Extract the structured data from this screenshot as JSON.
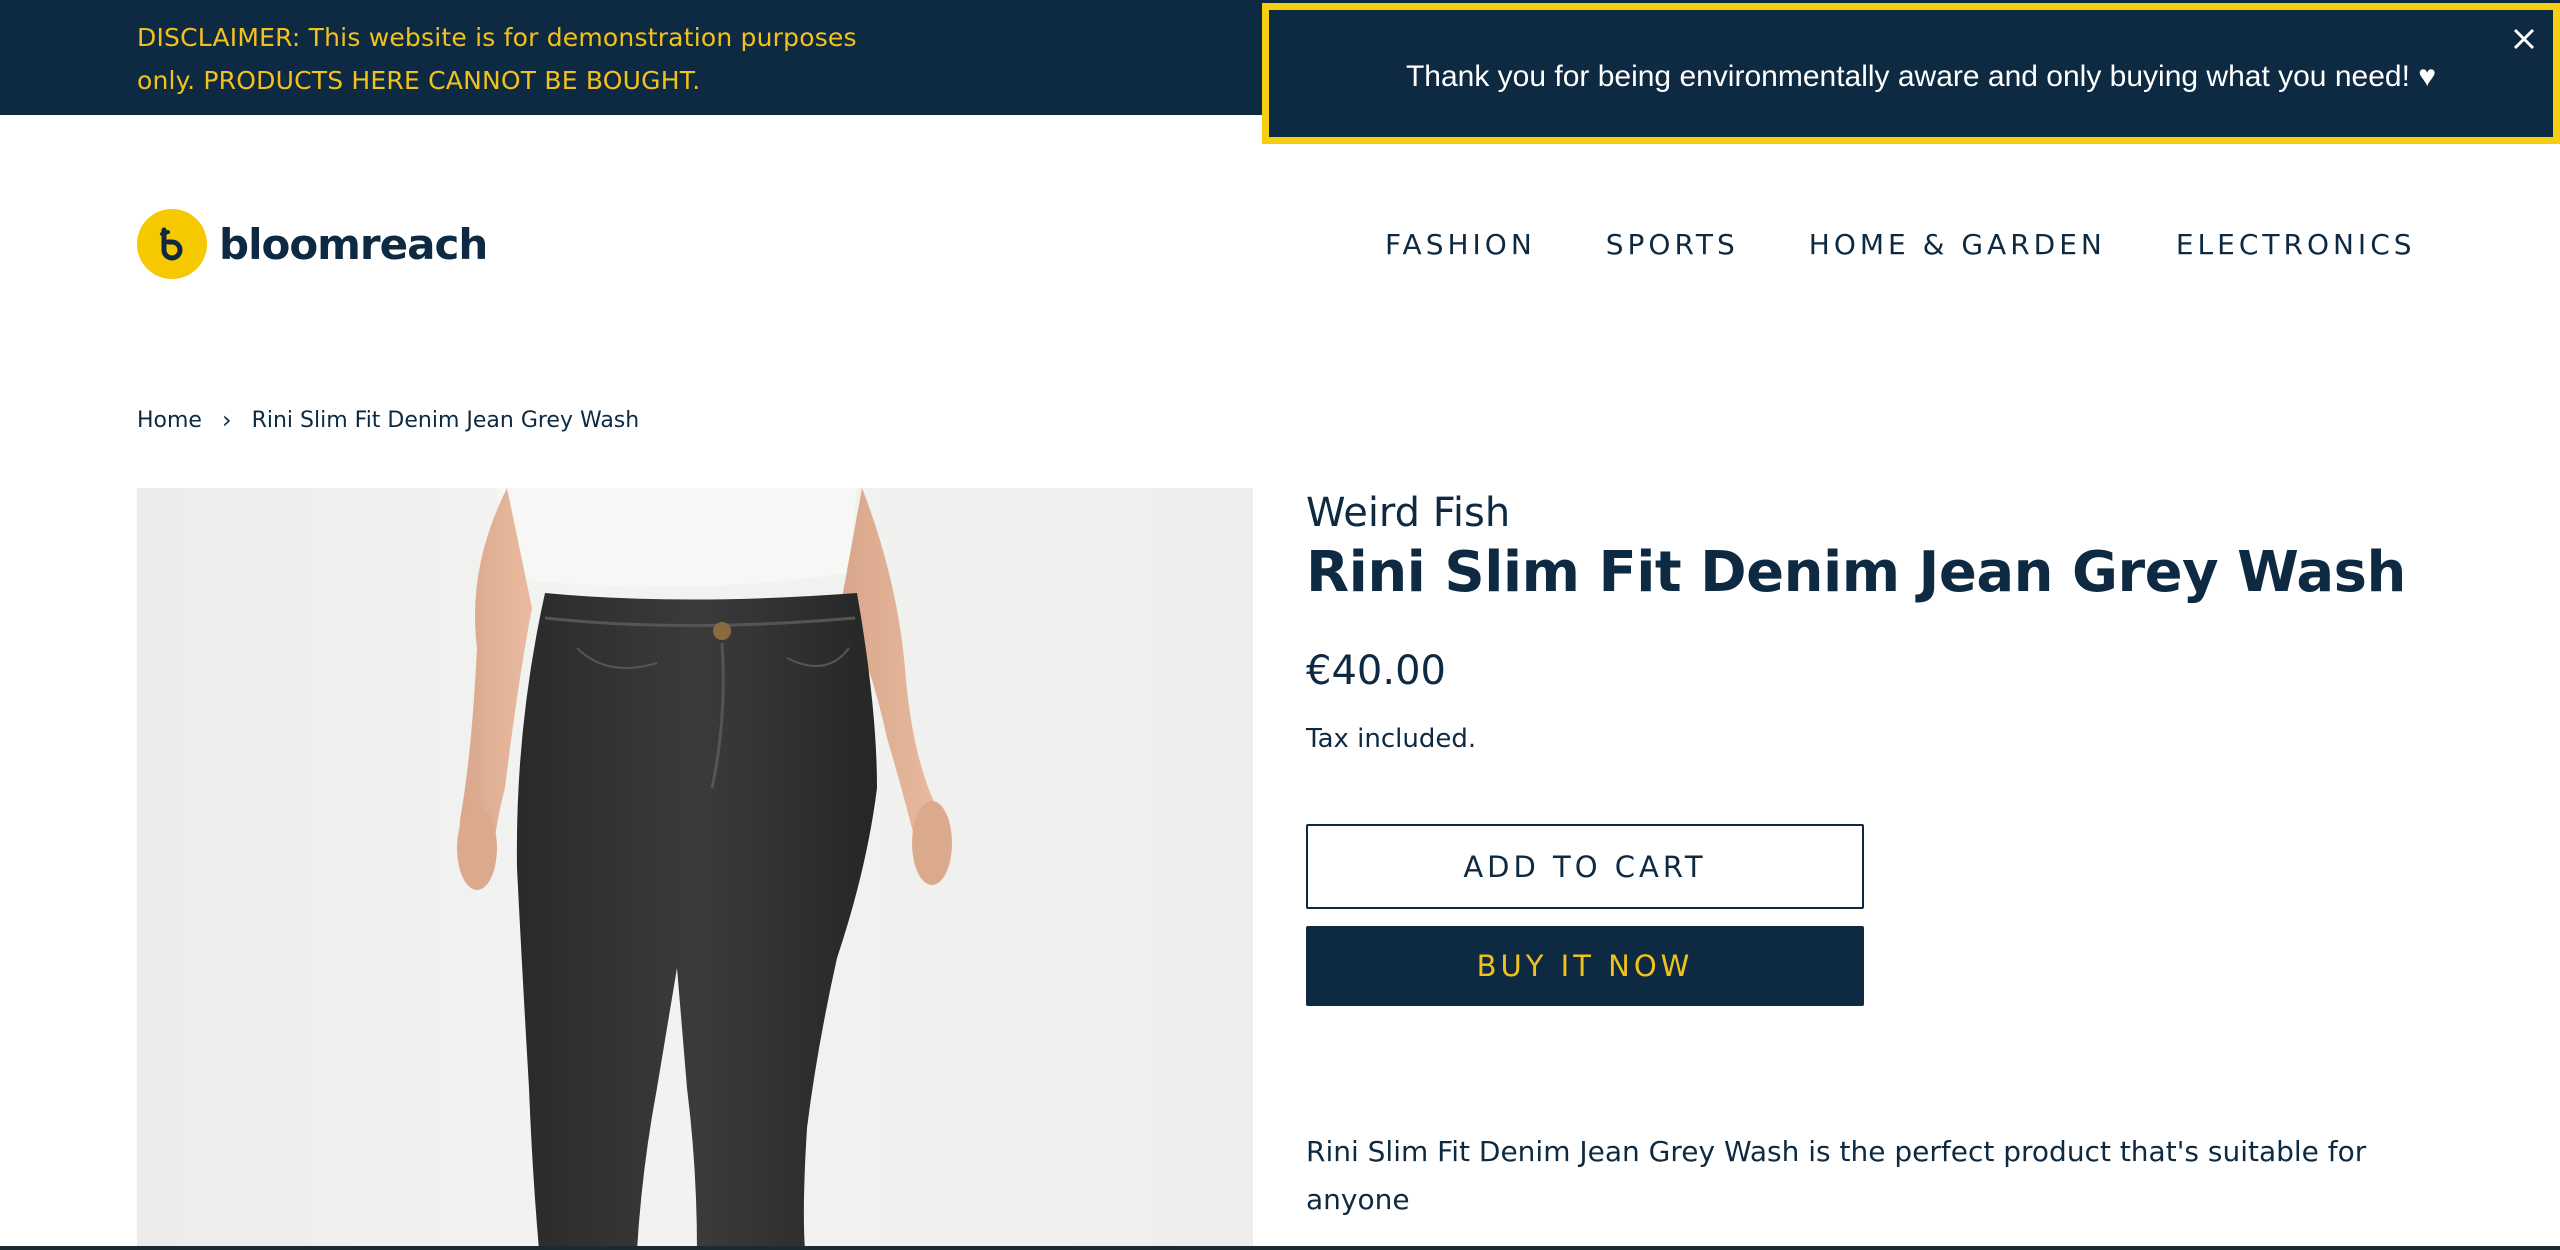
{
  "topbar": {
    "disclaimer": "DISCLAIMER: This website is for demonstration purposes only. PRODUCTS HERE CANNOT BE BOUGHT."
  },
  "popup": {
    "message": "Thank you for being environmentally aware and only buying what you need! ♥",
    "close_icon": "close-icon"
  },
  "header": {
    "logo_text": "bloomreach",
    "logo_icon": "bloomreach-logo-icon",
    "nav": [
      "FASHION",
      "SPORTS",
      "HOME & GARDEN",
      "ELECTRONICS"
    ]
  },
  "breadcrumb": {
    "home": "Home",
    "separator": "›",
    "current": "Rini Slim Fit Denim Jean Grey Wash"
  },
  "product": {
    "vendor": "Weird Fish",
    "title": "Rini Slim Fit Denim Jean Grey Wash",
    "price": "€40.00",
    "tax_note": "Tax included.",
    "add_to_cart_label": "ADD TO CART",
    "buy_now_label": "BUY IT NOW",
    "description": "Rini Slim Fit Denim Jean Grey Wash is the perfect product that's suitable for anyone"
  },
  "colors": {
    "navy": "#0d2a42",
    "yellow": "#f5c800",
    "gold_text": "#f2c21b",
    "popup_border": "#f5ce0f"
  }
}
